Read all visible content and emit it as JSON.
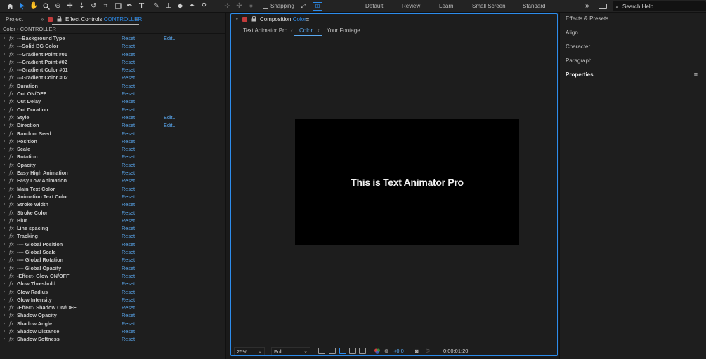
{
  "toolbar": {
    "snapping_label": "Snapping",
    "workspaces": [
      "Default",
      "Review",
      "Learn",
      "Small Screen",
      "Standard"
    ],
    "more_label": "»",
    "search_placeholder": "Search Help"
  },
  "left_panel": {
    "project_tab": "Project",
    "effect_controls_prefix": "Effect Controls",
    "effect_controls_layer": "CONTROLLER",
    "header": "Color • CONTROLLER",
    "properties": [
      {
        "name": "---Background Type",
        "reset": "Reset",
        "edit": "Edit..."
      },
      {
        "name": "---Solid BG Color",
        "reset": "Reset",
        "edit": ""
      },
      {
        "name": "---Gradient Point #01",
        "reset": "Reset",
        "edit": ""
      },
      {
        "name": "---Gradient Point #02",
        "reset": "Reset",
        "edit": ""
      },
      {
        "name": "---Gradient Color #01",
        "reset": "Reset",
        "edit": ""
      },
      {
        "name": "---Gradient Color #02",
        "reset": "Reset",
        "edit": ""
      },
      {
        "name": "Duration",
        "reset": "Reset",
        "edit": ""
      },
      {
        "name": "Out ON/OFF",
        "reset": "Reset",
        "edit": ""
      },
      {
        "name": "Out Delay",
        "reset": "Reset",
        "edit": ""
      },
      {
        "name": "Out Duration",
        "reset": "Reset",
        "edit": ""
      },
      {
        "name": "Style",
        "reset": "Reset",
        "edit": "Edit..."
      },
      {
        "name": "Direction",
        "reset": "Reset",
        "edit": "Edit..."
      },
      {
        "name": "Random Seed",
        "reset": "Reset",
        "edit": ""
      },
      {
        "name": "Position",
        "reset": "Reset",
        "edit": ""
      },
      {
        "name": "Scale",
        "reset": "Reset",
        "edit": ""
      },
      {
        "name": "Rotation",
        "reset": "Reset",
        "edit": ""
      },
      {
        "name": "Opacity",
        "reset": "Reset",
        "edit": ""
      },
      {
        "name": "Easy High Animation",
        "reset": "Reset",
        "edit": ""
      },
      {
        "name": "Easy Low Animation",
        "reset": "Reset",
        "edit": ""
      },
      {
        "name": "Main Text Color",
        "reset": "Reset",
        "edit": ""
      },
      {
        "name": "Animation Text Color",
        "reset": "Reset",
        "edit": ""
      },
      {
        "name": "Stroke Width",
        "reset": "Reset",
        "edit": ""
      },
      {
        "name": "Stroke Color",
        "reset": "Reset",
        "edit": ""
      },
      {
        "name": "Blur",
        "reset": "Reset",
        "edit": ""
      },
      {
        "name": "Line spacing",
        "reset": "Reset",
        "edit": ""
      },
      {
        "name": "Tracking",
        "reset": "Reset",
        "edit": ""
      },
      {
        "name": "---- Global Position",
        "reset": "Reset",
        "edit": ""
      },
      {
        "name": "---- Global Scale",
        "reset": "Reset",
        "edit": ""
      },
      {
        "name": "---- Global Rotation",
        "reset": "Reset",
        "edit": ""
      },
      {
        "name": "---- Global Opacity",
        "reset": "Reset",
        "edit": ""
      },
      {
        "name": "-Effect- Glow ON/OFF",
        "reset": "Reset",
        "edit": ""
      },
      {
        "name": "Glow Threshold",
        "reset": "Reset",
        "edit": ""
      },
      {
        "name": "Glow Radius",
        "reset": "Reset",
        "edit": ""
      },
      {
        "name": "Glow Intensity",
        "reset": "Reset",
        "edit": ""
      },
      {
        "name": "-Effect- Shadow ON/OFF",
        "reset": "Reset",
        "edit": ""
      },
      {
        "name": "Shadow Opacity",
        "reset": "Reset",
        "edit": ""
      },
      {
        "name": "Shadow Angle",
        "reset": "Reset",
        "edit": ""
      },
      {
        "name": "Shadow Distance",
        "reset": "Reset",
        "edit": ""
      },
      {
        "name": "Shadow Softness",
        "reset": "Reset",
        "edit": ""
      }
    ]
  },
  "composition": {
    "tab_prefix": "Composition",
    "tab_name": "Color",
    "breadcrumbs": [
      "Text Animator Pro",
      "Color",
      "Your Footage"
    ],
    "canvas_text": "This is Text Animator Pro",
    "zoom": "25%",
    "resolution": "Full",
    "exposure": "+0,0",
    "timecode": "0;00;01;20"
  },
  "right_panel": {
    "items": [
      "Effects & Presets",
      "Align",
      "Character",
      "Paragraph",
      "Properties"
    ]
  },
  "colors": {
    "accent": "#2d8ceb",
    "link": "#5aa9f1",
    "panel_bg": "#1e1e1e",
    "canvas_bg": "#000000"
  }
}
